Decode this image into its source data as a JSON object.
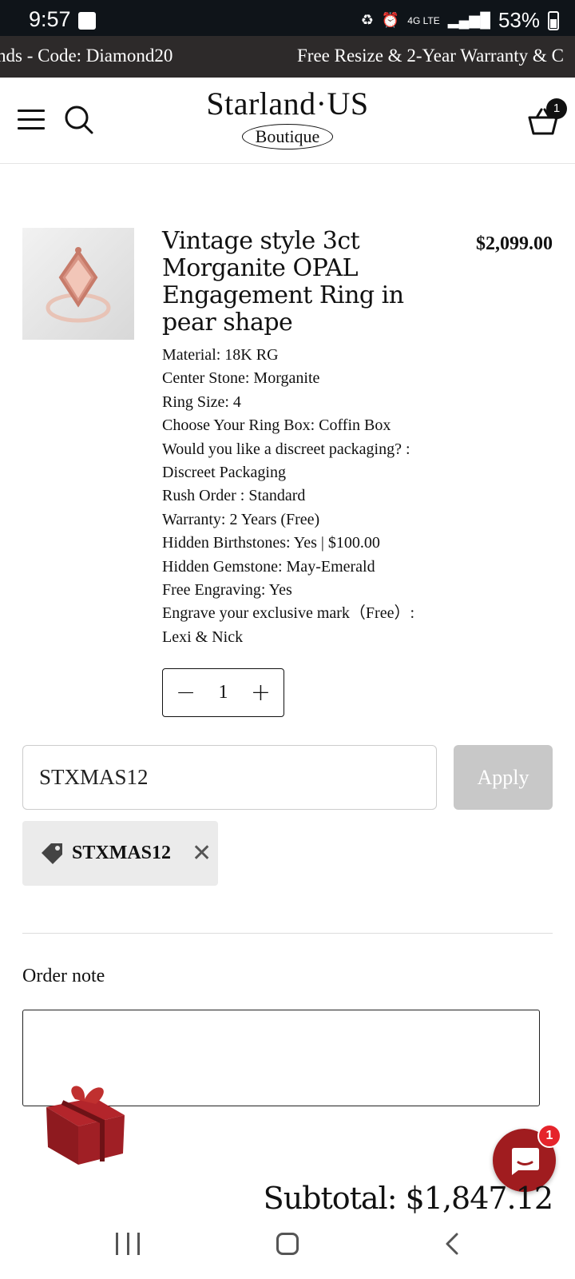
{
  "status": {
    "time": "9:57",
    "network": "4G LTE",
    "battery": "53%"
  },
  "promo": {
    "left_text": "nds - Code: Diamond20",
    "right_text": "Free Resize & 2-Year Warranty & C"
  },
  "header": {
    "logo_main": "Starland·US",
    "logo_sub": "Boutique",
    "cart_count": "1"
  },
  "product": {
    "title": "Vintage style 3ct Morganite OPAL Engagement Ring in pear shape",
    "price": "$2,099.00",
    "options": [
      "Material: 18K RG",
      "Center Stone: Morganite",
      "Ring Size: 4",
      "Choose Your Ring Box: Coffin Box",
      "Would you like a discreet packaging? :",
      "Discreet Packaging",
      "Rush Order : Standard",
      "Warranty: 2 Years (Free)",
      "Hidden Birthstones: Yes | $100.00",
      "Hidden Gemstone: May-Emerald",
      "Free Engraving: Yes",
      "Engrave your exclusive mark（Free）:",
      "Lexi & Nick"
    ],
    "quantity": "1"
  },
  "discount": {
    "input_value": "STXMAS12",
    "apply_label": "Apply",
    "applied_code": "STXMAS12"
  },
  "note": {
    "label": "Order note"
  },
  "chat": {
    "badge": "1"
  },
  "subtotal": {
    "text": "Subtotal: $1,847.12"
  },
  "colors": {
    "promo_bg": "#2d2a2a",
    "status_bg": "#0f1419",
    "chat_red": "#a01c1f",
    "apply_disabled": "#c8c8c8"
  }
}
